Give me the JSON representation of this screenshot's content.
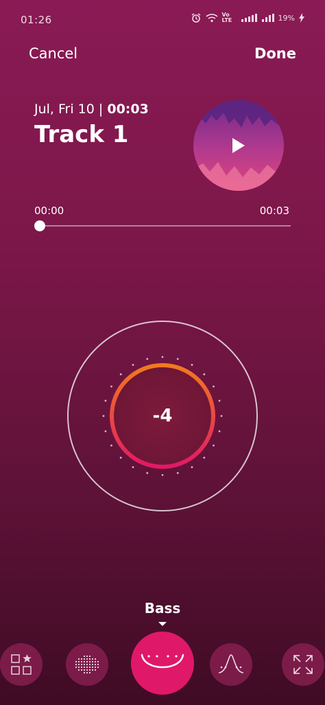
{
  "status_bar": {
    "time": "01:26",
    "volte": "Vo LTE",
    "battery_text": "19%"
  },
  "header": {
    "cancel_label": "Cancel",
    "done_label": "Done"
  },
  "track": {
    "date": "Jul, Fri 10",
    "separator": "|",
    "duration": "00:03",
    "title": "Track 1"
  },
  "player": {
    "current_time": "00:00",
    "total_time": "00:03",
    "progress_fraction": 0.0
  },
  "equalizer": {
    "value": "-4",
    "selected_mode": "Bass"
  },
  "modes": [
    {
      "icon": "grid-star-icon"
    },
    {
      "icon": "dots-sphere-icon"
    },
    {
      "icon": "bass-curve-icon"
    },
    {
      "icon": "peak-curve-icon"
    },
    {
      "icon": "expand-arrows-icon"
    }
  ],
  "colors": {
    "accent": "#e0186a",
    "ring_start": "#f27a1f",
    "ring_end": "#e21866",
    "background_top": "#8a1a55",
    "background_bottom": "#3f0b24"
  }
}
